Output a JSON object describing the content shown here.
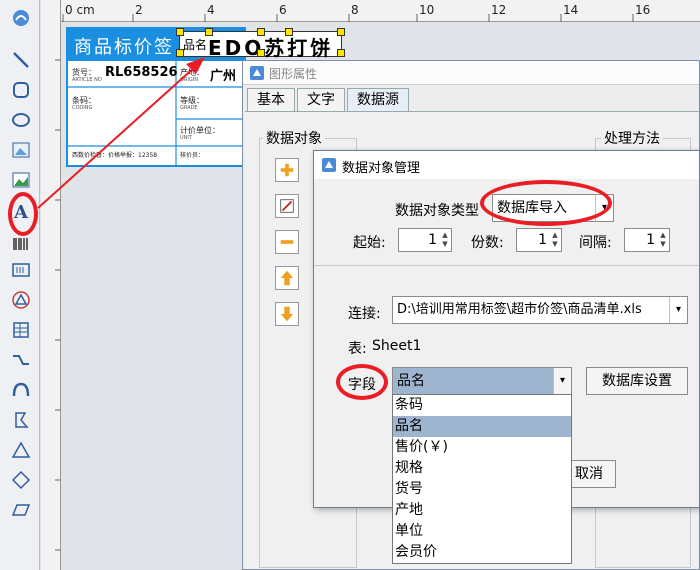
{
  "ruler": {
    "unit": "0 cm",
    "marks": [
      "2",
      "4",
      "6",
      "8",
      "10",
      "12",
      "14",
      "16"
    ]
  },
  "toolbar": {
    "tools": [
      {
        "name": "pointer-tool-icon"
      },
      {
        "name": "line-tool-icon"
      },
      {
        "name": "rounded-rect-tool-icon"
      },
      {
        "name": "ellipse-tool-icon"
      },
      {
        "name": "image-tool-icon"
      },
      {
        "name": "picture-tool-icon"
      },
      {
        "name": "text-tool-icon",
        "glyph": "A"
      },
      {
        "name": "barcode-tool-icon"
      },
      {
        "name": "serial-tool-icon"
      },
      {
        "name": "triangle-logo-tool-icon"
      },
      {
        "name": "table-tool-icon"
      },
      {
        "name": "curve-tool-icon"
      },
      {
        "name": "arc-tool-icon"
      },
      {
        "name": "polygon-tool-icon"
      },
      {
        "name": "triangle-tool-icon"
      },
      {
        "name": "diamond-tool-icon"
      },
      {
        "name": "parallelogram-tool-icon"
      }
    ]
  },
  "label": {
    "title": "商品标价签",
    "name_prefix": "品名",
    "product_name": "EDO苏打饼",
    "item_label": "货号：",
    "item_sub": "ARTICLE NO",
    "item_value": "RL658526",
    "origin_label": "产地：",
    "origin_sub": "ORIGIN",
    "origin_value": "广州",
    "barcode_label": "条码：",
    "barcode_sub": "CODING",
    "grade_label": "等级：",
    "grade_sub": "GRADE",
    "unit_label": "计价单位：",
    "unit_sub": "UNIT",
    "price_office": "西数价检督：价格举报：12358",
    "price_person": "核价员："
  },
  "propwin": {
    "title": "图形属性",
    "tabs": [
      "基本",
      "文字",
      "数据源"
    ],
    "data_object_group": "数据对象",
    "process_group": "处理方法"
  },
  "dialog": {
    "title": "数据对象管理",
    "type_label": "数据对象类型",
    "type_value": "数据库导入",
    "start_label": "起始:",
    "start_value": "1",
    "count_label": "份数:",
    "count_value": "1",
    "interval_label": "间隔:",
    "interval_value": "1",
    "connect_label": "连接:",
    "connect_value": "D:\\培训用常用标签\\超市价签\\商品清单.xls",
    "table_label": "表:",
    "table_value": "Sheet1",
    "field_label": "字段",
    "field_value": "品名",
    "db_settings_button": "数据库设置",
    "cancel_button": "取消",
    "field_options": [
      "条码",
      "品名",
      "售价(￥)",
      "规格",
      "货号",
      "产地",
      "单位",
      "会员价"
    ],
    "selected_option": "品名"
  },
  "colors": {
    "label_blue": "#1a8ee0",
    "highlight_red": "#ea1d25",
    "selection_blue": "#9fb5cf"
  }
}
